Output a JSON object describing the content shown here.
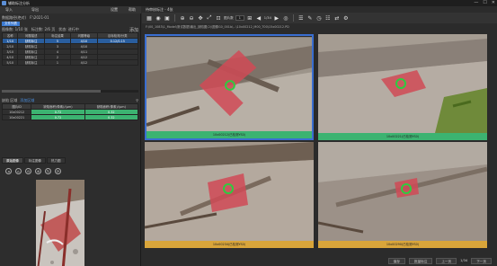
{
  "window": {
    "title": "辅助标注分析",
    "controls": [
      "—",
      "☐",
      "✕"
    ]
  },
  "menu": {
    "left": [
      "导入",
      "导出"
    ],
    "right": [
      "设置",
      "帮助"
    ]
  },
  "left": {
    "path_label": "数据路径(绝对)",
    "path_value": "F:\\2021-01",
    "tab": "文件列表",
    "info_items": [
      "图像数: 1/10 张",
      "标注数: 2/6 页",
      "状态: 进行中"
    ],
    "info_action": "添加",
    "table1": {
      "headers": [
        "名称",
        "问题描述",
        "标注结果",
        "问题等级",
        "目标检测/分类"
      ],
      "rows": [
        [
          "1/10",
          "缺陷标注",
          "5",
          "4/10",
          "0.12/0.15"
        ],
        [
          "2/10",
          "缺陷标注",
          "3",
          "4/10",
          ""
        ],
        [
          "3/10",
          "缺陷标注",
          "4",
          "4/11",
          ""
        ],
        [
          "4/10",
          "缺陷标注",
          "2",
          "4/12",
          ""
        ],
        [
          "5/10",
          "缺陷标注",
          "1",
          "4/12",
          ""
        ]
      ]
    },
    "section2": {
      "title": "缺陷 区域",
      "link": "添加区域",
      "pin": "⚲"
    },
    "table2": {
      "headers": [
        "图片ID",
        "缺陷面积(像素)/(μm)",
        "缺陷面积(像素)/(μm)"
      ],
      "rows": [
        [
          "10x00212",
          "0.72",
          "0.32"
        ],
        [
          "10x00221",
          "0.72",
          "0.32"
        ]
      ]
    },
    "bottom_tabs": [
      "原始图像",
      "标注图像",
      "热力图"
    ],
    "tools": [
      "◂",
      "⌂",
      "⊖",
      "⊕",
      "↻",
      "⟳"
    ]
  },
  "right": {
    "title": "待审核标注 - 4张",
    "toolbar": {
      "scale_label": "图片数",
      "page_prev": "1",
      "page_value": "1/34",
      "icons": [
        "grid-icon",
        "wifi-icon",
        "zoom-in-icon",
        "zoom-out-icon",
        "move-icon",
        "zoom-fit-icon",
        "image-icon"
      ]
    },
    "path": "F:\\00_1083\\1_Model\\测试数据\\输出_缺陷图(2)\\图像G0_001b\\...\\10x00212_M00_T00\\15x00212.PD",
    "cells": [
      {
        "caption": "10x00212(已检测YS0)",
        "status": "approved"
      },
      {
        "caption": "10x00221(已检测YS0)",
        "status": "approved"
      },
      {
        "caption": "10x00234(已检测YS0)",
        "status": "pending"
      },
      {
        "caption": "10x00290(已检测YS0)",
        "status": "pending"
      }
    ],
    "status": {
      "btn_confirm": "保存",
      "btn_reject": "批量标注",
      "btn_page": "上一页",
      "page": "1/34",
      "btn_next": "下一页"
    }
  },
  "colors": {
    "approved": "#3cb371",
    "pending": "#d9a53a",
    "accent": "#3d7bd1"
  }
}
